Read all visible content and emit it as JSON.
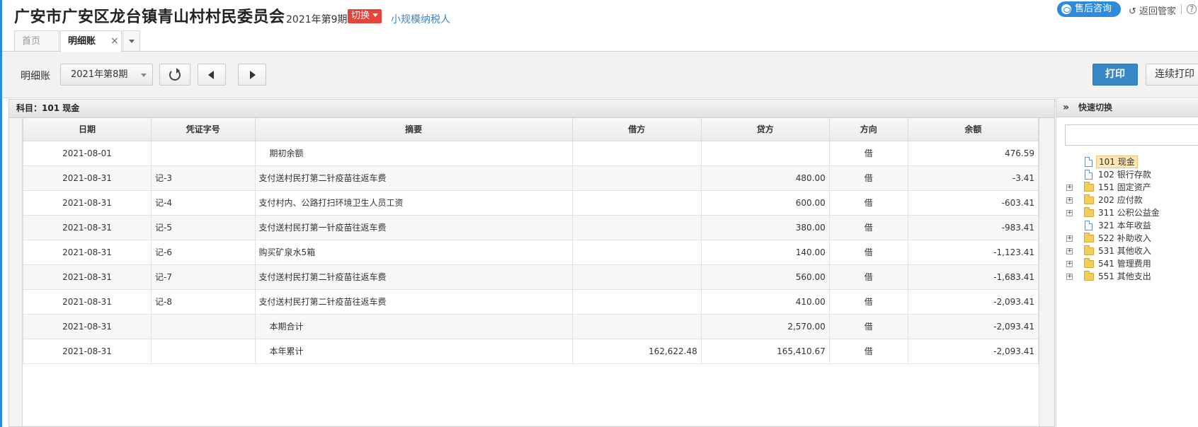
{
  "header": {
    "company": "广安市广安区龙台镇青山村村民委员会",
    "period": "2021年第9期",
    "switch_label": "切换",
    "taxpayer": "小规模纳税人",
    "consult_label": "售后咨询",
    "return_label": "返回管家",
    "help_glyph": "?"
  },
  "tabs": {
    "home": "首页",
    "active": "明细账",
    "close_glyph": "×"
  },
  "toolbar": {
    "label": "明细账",
    "period_select": "2021年第8期",
    "print": "打印",
    "continuous_print": "连续打印"
  },
  "ledger": {
    "subject": "科目：101  现金",
    "columns": [
      "日期",
      "凭证字号",
      "摘要",
      "借方",
      "贷方",
      "方向",
      "余额"
    ],
    "rows": [
      {
        "date": "2021-08-01",
        "voucher": "",
        "summary": "期初余额",
        "debit": "",
        "credit": "",
        "dir": "借",
        "balance": "476.59",
        "indent": true
      },
      {
        "date": "2021-08-31",
        "voucher": "记-3",
        "summary": "支付送村民打第二针疫苗往返车费",
        "debit": "",
        "credit": "480.00",
        "dir": "借",
        "balance": "-3.41",
        "indent": false
      },
      {
        "date": "2021-08-31",
        "voucher": "记-4",
        "summary": "支付村内、公路打扫环境卫生人员工资",
        "debit": "",
        "credit": "600.00",
        "dir": "借",
        "balance": "-603.41",
        "indent": false
      },
      {
        "date": "2021-08-31",
        "voucher": "记-5",
        "summary": "支付送村民打第一针疫苗往返车费",
        "debit": "",
        "credit": "380.00",
        "dir": "借",
        "balance": "-983.41",
        "indent": false
      },
      {
        "date": "2021-08-31",
        "voucher": "记-6",
        "summary": "购买矿泉水5箱",
        "debit": "",
        "credit": "140.00",
        "dir": "借",
        "balance": "-1,123.41",
        "indent": false
      },
      {
        "date": "2021-08-31",
        "voucher": "记-7",
        "summary": "支付送村民打第二针疫苗往返车费",
        "debit": "",
        "credit": "560.00",
        "dir": "借",
        "balance": "-1,683.41",
        "indent": false
      },
      {
        "date": "2021-08-31",
        "voucher": "记-8",
        "summary": "支付送村民打第二针疫苗往返车费",
        "debit": "",
        "credit": "410.00",
        "dir": "借",
        "balance": "-2,093.41",
        "indent": false
      },
      {
        "date": "2021-08-31",
        "voucher": "",
        "summary": "本期合计",
        "debit": "",
        "credit": "2,570.00",
        "dir": "借",
        "balance": "-2,093.41",
        "indent": true
      },
      {
        "date": "2021-08-31",
        "voucher": "",
        "summary": "本年累计",
        "debit": "162,622.48",
        "credit": "165,410.67",
        "dir": "借",
        "balance": "-2,093.41",
        "indent": true
      }
    ]
  },
  "quick_switch": {
    "title": "快速切换",
    "expand_glyph": "»",
    "items": [
      {
        "code": "101",
        "name": "现金",
        "type": "doc",
        "expandable": false,
        "selected": true
      },
      {
        "code": "102",
        "name": "银行存款",
        "type": "doc",
        "expandable": false,
        "selected": false
      },
      {
        "code": "151",
        "name": "固定资产",
        "type": "folder",
        "expandable": true,
        "selected": false
      },
      {
        "code": "202",
        "name": "应付款",
        "type": "folder",
        "expandable": true,
        "selected": false
      },
      {
        "code": "311",
        "name": "公积公益金",
        "type": "folder",
        "expandable": true,
        "selected": false
      },
      {
        "code": "321",
        "name": "本年收益",
        "type": "doc",
        "expandable": false,
        "selected": false
      },
      {
        "code": "522",
        "name": "补助收入",
        "type": "folder",
        "expandable": true,
        "selected": false
      },
      {
        "code": "531",
        "name": "其他收入",
        "type": "folder",
        "expandable": true,
        "selected": false
      },
      {
        "code": "541",
        "name": "管理费用",
        "type": "folder",
        "expandable": true,
        "selected": false
      },
      {
        "code": "551",
        "name": "其他支出",
        "type": "folder",
        "expandable": true,
        "selected": false
      }
    ]
  },
  "colors": {
    "accent_blue": "#2e8bdc",
    "switch_red": "#e6433a",
    "print_button": "#3a87c6",
    "selected_tree": "#fde7b4"
  }
}
